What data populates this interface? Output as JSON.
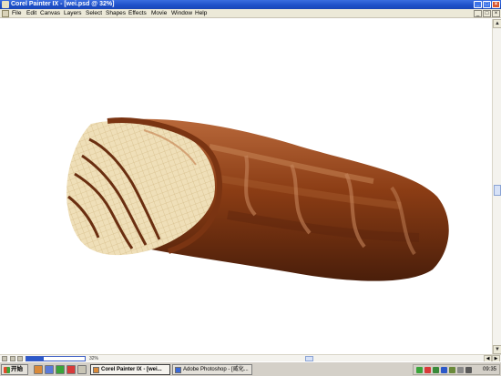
{
  "window": {
    "title": "Corel Painter IX - [wei.psd @ 32%]",
    "controls": {
      "minimize": "_",
      "maximize": "□",
      "close": "×"
    }
  },
  "menubar": {
    "items": [
      "File",
      "Edit",
      "Canvas",
      "Layers",
      "Select",
      "Shapes",
      "Effects",
      "Movie",
      "Window",
      "Help"
    ],
    "doc_controls": {
      "minimize": "_",
      "restore": "□",
      "close": "×"
    }
  },
  "canvas": {
    "subject": "chocolate-wafer-bar-painting",
    "colors": {
      "chocolate_dark": "#4a1e0a",
      "chocolate_mid": "#8a3c14",
      "chocolate_light": "#b86a3a",
      "wafer": "#efdfb8"
    }
  },
  "statusbar": {
    "zoom": "32%",
    "navigator_fill": 0.3
  },
  "taskbar": {
    "start_label": "开始",
    "tasks": [
      {
        "label": "Corel Painter IX - [wei...",
        "active": true
      },
      {
        "label": "Adobe Photoshop - [威化...",
        "active": false
      }
    ],
    "clock": "09:35"
  }
}
